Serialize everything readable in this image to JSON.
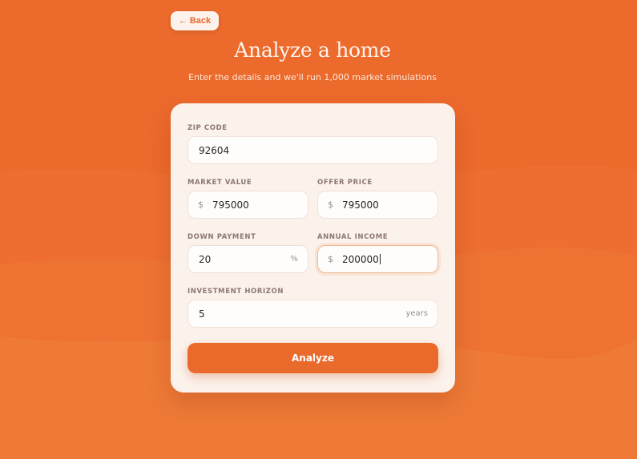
{
  "header": {
    "back_label": "Back",
    "title": "Analyze a home",
    "subtitle": "Enter the details and we'll run 1,000 market simulations"
  },
  "form": {
    "zip": {
      "label": "ZIP CODE",
      "value": "92604"
    },
    "market_value": {
      "label": "MARKET VALUE",
      "prefix": "$",
      "value": "795000"
    },
    "offer_price": {
      "label": "OFFER PRICE",
      "prefix": "$",
      "value": "795000"
    },
    "down_payment": {
      "label": "DOWN PAYMENT",
      "suffix": "%",
      "value": "20"
    },
    "annual_income": {
      "label": "ANNUAL INCOME",
      "prefix": "$",
      "value": "200000"
    },
    "horizon": {
      "label": "INVESTMENT HORIZON",
      "suffix": "years",
      "value": "5"
    },
    "submit_label": "Analyze"
  },
  "colors": {
    "background": "#ec6a2c",
    "card": "#fcf2ec",
    "accent": "#ea6a2c"
  },
  "icons": {
    "back": "left-arrow-icon"
  }
}
